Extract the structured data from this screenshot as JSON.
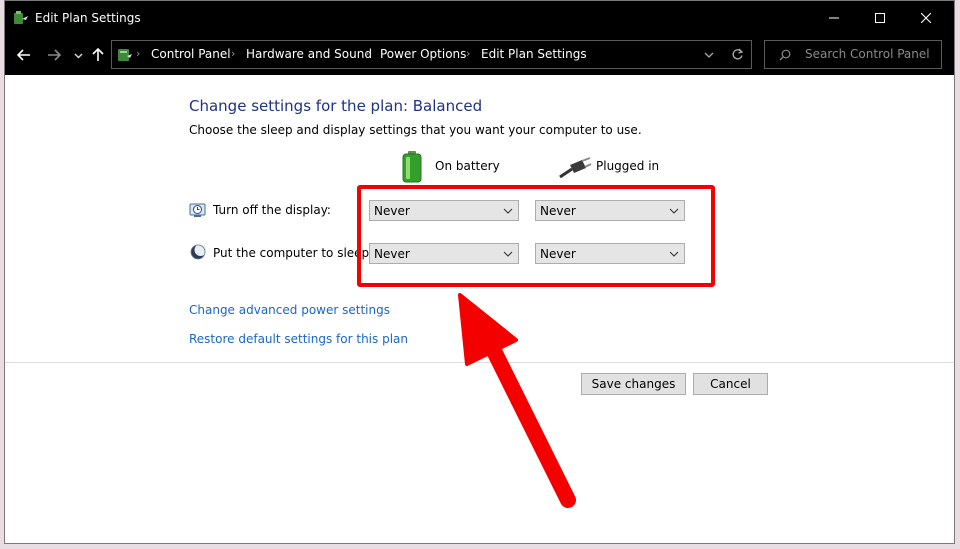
{
  "window": {
    "title": "Edit Plan Settings",
    "icons": {
      "app": "power-options-icon",
      "minimize": "minimize-icon",
      "maximize": "maximize-icon",
      "close": "close-icon"
    }
  },
  "nav": {
    "icons": {
      "back": "back-arrow-icon",
      "forward": "forward-arrow-icon",
      "recent": "chevron-down-icon",
      "up": "up-arrow-icon",
      "refresh": "refresh-icon",
      "search": "search-icon"
    },
    "breadcrumb": [
      "Control Panel",
      "Hardware and Sound",
      "Power Options",
      "Edit Plan Settings"
    ],
    "search_placeholder": "Search Control Panel"
  },
  "main": {
    "heading": "Change settings for the plan: Balanced",
    "subtitle": "Choose the sleep and display settings that you want your computer to use.",
    "columns": {
      "battery": "On battery",
      "plugged": "Plugged in"
    },
    "rows": [
      {
        "label": "Turn off the display:",
        "icon": "display-timer-icon",
        "battery": "Never",
        "plugged": "Never"
      },
      {
        "label": "Put the computer to sleep:",
        "icon": "sleep-moon-icon",
        "battery": "Never",
        "plugged": "Never"
      }
    ],
    "links": {
      "advanced": "Change advanced power settings",
      "restore": "Restore default settings for this plan"
    },
    "buttons": {
      "save": "Save changes",
      "cancel": "Cancel"
    }
  },
  "annotation": {
    "color": "#f40000"
  },
  "colors": {
    "link": "#1a66c6",
    "heading": "#1e3287",
    "titlebar": "#000000"
  }
}
